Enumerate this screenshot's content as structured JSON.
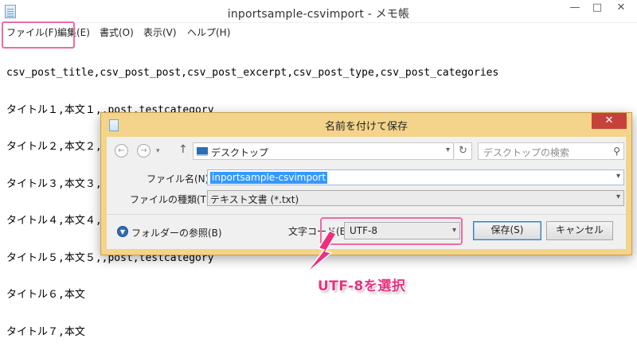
{
  "notepad": {
    "title": "inportsample-csvimport - メモ帳",
    "window_controls": [
      "—",
      "□",
      "✕"
    ],
    "menu": [
      "ファイル(F)",
      "編集(E)",
      "書式(O)",
      "表示(V)",
      "ヘルプ(H)"
    ],
    "lines": [
      "csv_post_title,csv_post_post,csv_post_excerpt,csv_post_type,csv_post_categories",
      "タイトル１,本文１,,post,testcategory",
      "タイトル２,本文２,,post,testcategory",
      "タイトル３,本文３,,post,testcategory",
      "タイトル４,本文４,,post,testcategory",
      "タイトル５,本文５,,post,testcategory",
      "タイトル６,本文",
      "タイトル７,本文"
    ]
  },
  "dialog": {
    "title": "名前を付けて保存",
    "close_glyph": "✕",
    "nav": {
      "back": "←",
      "forward": "→",
      "recent": "▾",
      "up": "↑"
    },
    "address": "デスクトップ",
    "refresh_glyph": "↻",
    "search_placeholder": "デスクトップの検索",
    "filename_label": "ファイル名(N):",
    "filename_value": "inportsample-csvimport",
    "filetype_label": "ファイルの種類(T):",
    "filetype_value": "テキスト文書 (*.txt)",
    "browse_folders_label": "フォルダーの参照(B)",
    "encoding_label": "文字コード(E):",
    "encoding_value": "UTF-8",
    "save_button": "保存(S)",
    "cancel_button": "キャンセル"
  },
  "annotation": {
    "callout": "UTF-8を選択",
    "color": "#ee2f7d"
  },
  "colors": {
    "dialog_frame": "#f4d48a",
    "close_button": "#c7413b",
    "highlight": "#f06aa3",
    "selection": "#3399ff"
  }
}
